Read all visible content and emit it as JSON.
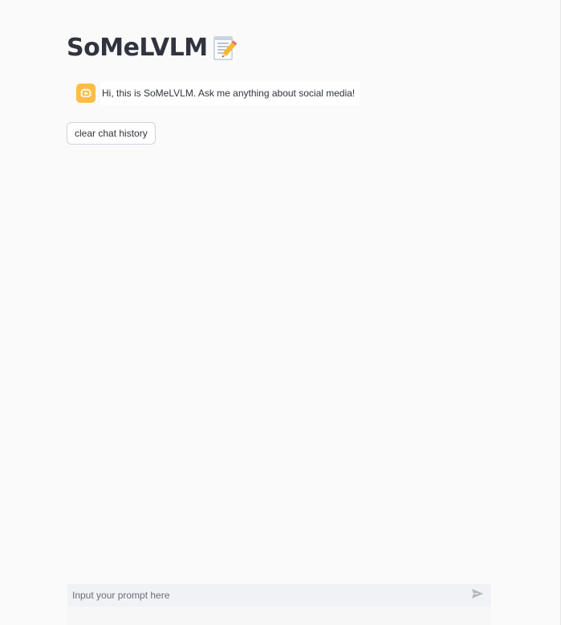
{
  "header": {
    "title": "SoMeLVLM",
    "title_icon": "memo-icon"
  },
  "chat": {
    "messages": [
      {
        "role": "assistant",
        "avatar_icon": "robot-icon",
        "avatar_color": "#ffbd45",
        "text": "Hi, this is SoMeLVLM. Ask me anything about social media!"
      }
    ]
  },
  "controls": {
    "clear_label": "clear chat history"
  },
  "prompt_input": {
    "value": "",
    "placeholder": "Input your prompt here",
    "send_icon": "send-icon"
  },
  "colors": {
    "background": "#fafafa",
    "text": "#31333f",
    "avatar": "#ffbd45",
    "input_background": "#f0f2f6"
  }
}
